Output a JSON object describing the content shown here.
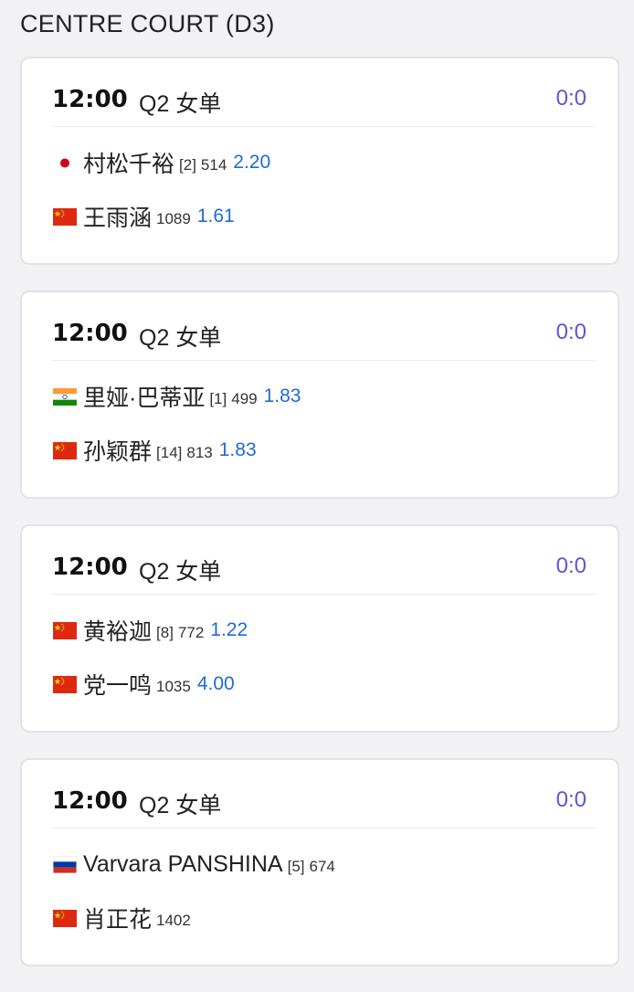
{
  "court": {
    "title": "CENTRE COURT (D3)"
  },
  "colors": {
    "score": "#5b55d6",
    "odds": "#1f6ad6"
  },
  "matches": [
    {
      "time": "12:00",
      "round": "Q2 女单",
      "score": "0:0",
      "players": [
        {
          "flag_icon": "japan-flag-icon",
          "name": "村松千裕",
          "seed": "[2]",
          "rank": "514",
          "odds": "2.20"
        },
        {
          "flag_icon": "china-flag-icon",
          "name": "王雨涵",
          "seed": "",
          "rank": "1089",
          "odds": "1.61"
        }
      ]
    },
    {
      "time": "12:00",
      "round": "Q2 女单",
      "score": "0:0",
      "players": [
        {
          "flag_icon": "india-flag-icon",
          "name": "里娅·巴蒂亚",
          "seed": "[1]",
          "rank": "499",
          "odds": "1.83"
        },
        {
          "flag_icon": "china-flag-icon",
          "name": "孙颖群",
          "seed": "[14]",
          "rank": "813",
          "odds": "1.83"
        }
      ]
    },
    {
      "time": "12:00",
      "round": "Q2 女单",
      "score": "0:0",
      "players": [
        {
          "flag_icon": "china-flag-icon",
          "name": "黄裕迦",
          "seed": "[8]",
          "rank": "772",
          "odds": "1.22"
        },
        {
          "flag_icon": "china-flag-icon",
          "name": "党一鸣",
          "seed": "",
          "rank": "1035",
          "odds": "4.00"
        }
      ]
    },
    {
      "time": "12:00",
      "round": "Q2 女单",
      "score": "0:0",
      "players": [
        {
          "flag_icon": "russia-flag-icon",
          "name": "Varvara PANSHINA",
          "seed": "[5]",
          "rank": "674",
          "odds": ""
        },
        {
          "flag_icon": "china-flag-icon",
          "name": "肖正花",
          "seed": "",
          "rank": "1402",
          "odds": ""
        }
      ]
    }
  ]
}
